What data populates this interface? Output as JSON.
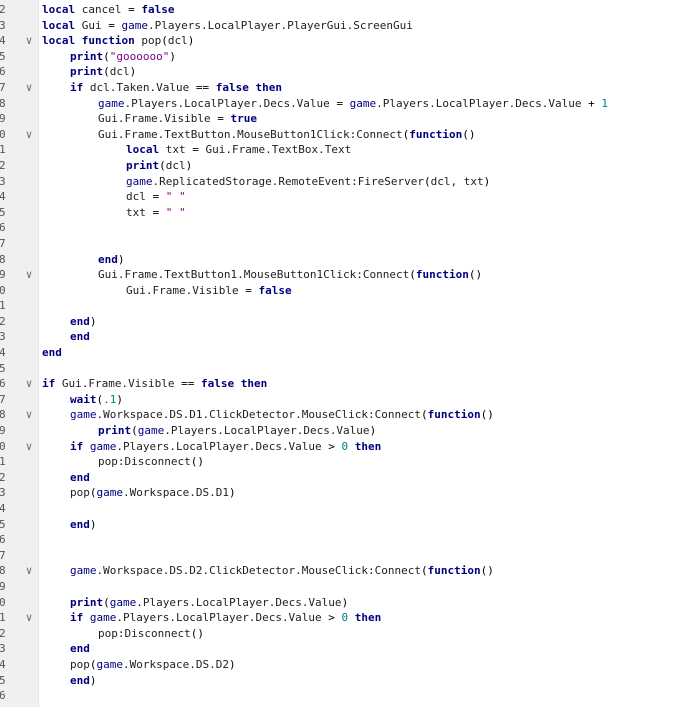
{
  "editor": {
    "colors": {
      "keyword": "#00007f",
      "string": "#7f007f",
      "number": "#007f7f",
      "text": "#1e1e1e",
      "gutter": "#f0f0f0"
    },
    "lines": [
      {
        "num": "2",
        "fold": false,
        "indent": 0,
        "tokens": [
          [
            "kw",
            "local"
          ],
          [
            "plain",
            " cancel "
          ],
          [
            "op",
            "="
          ],
          [
            "plain",
            " "
          ],
          [
            "kw",
            "false"
          ]
        ]
      },
      {
        "num": "3",
        "fold": false,
        "indent": 0,
        "tokens": [
          [
            "kw",
            "local"
          ],
          [
            "plain",
            " Gui "
          ],
          [
            "op",
            "="
          ],
          [
            "plain",
            " "
          ],
          [
            "glb",
            "game"
          ],
          [
            "plain",
            ".Players.LocalPlayer.PlayerGui.ScreenGui"
          ]
        ]
      },
      {
        "num": "4",
        "fold": true,
        "indent": 0,
        "tokens": [
          [
            "kw",
            "local"
          ],
          [
            "plain",
            " "
          ],
          [
            "kw",
            "function"
          ],
          [
            "plain",
            " pop"
          ],
          [
            "op",
            "("
          ],
          [
            "plain",
            "dcl"
          ],
          [
            "op",
            ")"
          ]
        ]
      },
      {
        "num": "5",
        "fold": false,
        "indent": 1,
        "tokens": [
          [
            "kw",
            "print"
          ],
          [
            "op",
            "("
          ],
          [
            "str",
            "\"goooooo\""
          ],
          [
            "op",
            ")"
          ]
        ]
      },
      {
        "num": "6",
        "fold": false,
        "indent": 1,
        "tokens": [
          [
            "kw",
            "print"
          ],
          [
            "op",
            "("
          ],
          [
            "plain",
            "dcl"
          ],
          [
            "op",
            ")"
          ]
        ]
      },
      {
        "num": "7",
        "fold": true,
        "indent": 1,
        "tokens": [
          [
            "kw",
            "if"
          ],
          [
            "plain",
            " dcl.Taken.Value "
          ],
          [
            "op",
            "=="
          ],
          [
            "plain",
            " "
          ],
          [
            "kw",
            "false"
          ],
          [
            "plain",
            " "
          ],
          [
            "kw",
            "then"
          ]
        ]
      },
      {
        "num": "8",
        "fold": false,
        "indent": 2,
        "tokens": [
          [
            "glb",
            "game"
          ],
          [
            "plain",
            ".Players.LocalPlayer.Decs.Value "
          ],
          [
            "op",
            "="
          ],
          [
            "plain",
            " "
          ],
          [
            "glb",
            "game"
          ],
          [
            "plain",
            ".Players.LocalPlayer.Decs.Value "
          ],
          [
            "op",
            "+"
          ],
          [
            "plain",
            " "
          ],
          [
            "num",
            "1"
          ]
        ]
      },
      {
        "num": "9",
        "fold": false,
        "indent": 2,
        "tokens": [
          [
            "plain",
            "Gui.Frame.Visible "
          ],
          [
            "op",
            "="
          ],
          [
            "plain",
            " "
          ],
          [
            "kw",
            "true"
          ]
        ]
      },
      {
        "num": "0",
        "fold": true,
        "indent": 2,
        "tokens": [
          [
            "plain",
            "Gui.Frame.TextButton.MouseButton1Click:Connect"
          ],
          [
            "op",
            "("
          ],
          [
            "kw",
            "function"
          ],
          [
            "op",
            "()"
          ]
        ]
      },
      {
        "num": "1",
        "fold": false,
        "indent": 3,
        "tokens": [
          [
            "kw",
            "local"
          ],
          [
            "plain",
            " txt "
          ],
          [
            "op",
            "="
          ],
          [
            "plain",
            " Gui.Frame.TextBox.Text"
          ]
        ]
      },
      {
        "num": "2",
        "fold": false,
        "indent": 3,
        "tokens": [
          [
            "kw",
            "print"
          ],
          [
            "op",
            "("
          ],
          [
            "plain",
            "dcl"
          ],
          [
            "op",
            ")"
          ]
        ]
      },
      {
        "num": "3",
        "fold": false,
        "indent": 3,
        "tokens": [
          [
            "glb",
            "game"
          ],
          [
            "plain",
            ".ReplicatedStorage.RemoteEvent:FireServer"
          ],
          [
            "op",
            "("
          ],
          [
            "plain",
            "dcl, txt"
          ],
          [
            "op",
            ")"
          ]
        ]
      },
      {
        "num": "4",
        "fold": false,
        "indent": 3,
        "tokens": [
          [
            "plain",
            "dcl "
          ],
          [
            "op",
            "="
          ],
          [
            "plain",
            " "
          ],
          [
            "str",
            "\" \""
          ]
        ]
      },
      {
        "num": "5",
        "fold": false,
        "indent": 3,
        "tokens": [
          [
            "plain",
            "txt "
          ],
          [
            "op",
            "="
          ],
          [
            "plain",
            " "
          ],
          [
            "str",
            "\" \""
          ]
        ]
      },
      {
        "num": "6",
        "fold": false,
        "indent": 0,
        "tokens": []
      },
      {
        "num": "7",
        "fold": false,
        "indent": 0,
        "tokens": []
      },
      {
        "num": "8",
        "fold": false,
        "indent": 2,
        "tokens": [
          [
            "kw",
            "end"
          ],
          [
            "op",
            ")"
          ]
        ]
      },
      {
        "num": "9",
        "fold": true,
        "indent": 2,
        "tokens": [
          [
            "plain",
            "Gui.Frame.TextButton1.MouseButton1Click:Connect"
          ],
          [
            "op",
            "("
          ],
          [
            "kw",
            "function"
          ],
          [
            "op",
            "()"
          ]
        ]
      },
      {
        "num": "0",
        "fold": false,
        "indent": 3,
        "tokens": [
          [
            "plain",
            "Gui.Frame.Visible "
          ],
          [
            "op",
            "="
          ],
          [
            "plain",
            " "
          ],
          [
            "kw",
            "false"
          ]
        ]
      },
      {
        "num": "1",
        "fold": false,
        "indent": 0,
        "tokens": []
      },
      {
        "num": "2",
        "fold": false,
        "indent": 1,
        "tokens": [
          [
            "kw",
            "end"
          ],
          [
            "op",
            ")"
          ]
        ]
      },
      {
        "num": "3",
        "fold": false,
        "indent": 1,
        "tokens": [
          [
            "kw",
            "end"
          ]
        ]
      },
      {
        "num": "4",
        "fold": false,
        "indent": 0,
        "tokens": [
          [
            "kw",
            "end"
          ]
        ]
      },
      {
        "num": "5",
        "fold": false,
        "indent": 0,
        "tokens": []
      },
      {
        "num": "6",
        "fold": true,
        "indent": 0,
        "tokens": [
          [
            "kw",
            "if"
          ],
          [
            "plain",
            " Gui.Frame.Visible "
          ],
          [
            "op",
            "=="
          ],
          [
            "plain",
            " "
          ],
          [
            "kw",
            "false"
          ],
          [
            "plain",
            " "
          ],
          [
            "kw",
            "then"
          ]
        ]
      },
      {
        "num": "7",
        "fold": false,
        "indent": 1,
        "tokens": [
          [
            "kw",
            "wait"
          ],
          [
            "op",
            "("
          ],
          [
            "num",
            ".1"
          ],
          [
            "op",
            ")"
          ]
        ]
      },
      {
        "num": "8",
        "fold": true,
        "indent": 1,
        "tokens": [
          [
            "glb",
            "game"
          ],
          [
            "plain",
            ".Workspace.DS.D1.ClickDetector.MouseClick:Connect"
          ],
          [
            "op",
            "("
          ],
          [
            "kw",
            "function"
          ],
          [
            "op",
            "()"
          ]
        ]
      },
      {
        "num": "9",
        "fold": false,
        "indent": 2,
        "tokens": [
          [
            "kw",
            "print"
          ],
          [
            "op",
            "("
          ],
          [
            "glb",
            "game"
          ],
          [
            "plain",
            ".Players.LocalPlayer.Decs.Value"
          ],
          [
            "op",
            ")"
          ]
        ]
      },
      {
        "num": "0",
        "fold": true,
        "indent": 1,
        "tokens": [
          [
            "kw",
            "if"
          ],
          [
            "plain",
            " "
          ],
          [
            "glb",
            "game"
          ],
          [
            "plain",
            ".Players.LocalPlayer.Decs.Value "
          ],
          [
            "op",
            ">"
          ],
          [
            "plain",
            " "
          ],
          [
            "num",
            "0"
          ],
          [
            "plain",
            " "
          ],
          [
            "kw",
            "then"
          ]
        ]
      },
      {
        "num": "1",
        "fold": false,
        "indent": 2,
        "tokens": [
          [
            "plain",
            "pop:Disconnect"
          ],
          [
            "op",
            "()"
          ]
        ]
      },
      {
        "num": "2",
        "fold": false,
        "indent": 1,
        "tokens": [
          [
            "kw",
            "end"
          ]
        ]
      },
      {
        "num": "3",
        "fold": false,
        "indent": 1,
        "tokens": [
          [
            "plain",
            "pop"
          ],
          [
            "op",
            "("
          ],
          [
            "glb",
            "game"
          ],
          [
            "plain",
            ".Workspace.DS.D1"
          ],
          [
            "op",
            ")"
          ]
        ]
      },
      {
        "num": "4",
        "fold": false,
        "indent": 0,
        "tokens": []
      },
      {
        "num": "5",
        "fold": false,
        "indent": 1,
        "tokens": [
          [
            "kw",
            "end"
          ],
          [
            "op",
            ")"
          ]
        ]
      },
      {
        "num": "6",
        "fold": false,
        "indent": 0,
        "tokens": []
      },
      {
        "num": "7",
        "fold": false,
        "indent": 0,
        "tokens": []
      },
      {
        "num": "8",
        "fold": true,
        "indent": 1,
        "tokens": [
          [
            "glb",
            "game"
          ],
          [
            "plain",
            ".Workspace.DS.D2.ClickDetector.MouseClick:Connect"
          ],
          [
            "op",
            "("
          ],
          [
            "kw",
            "function"
          ],
          [
            "op",
            "()"
          ]
        ]
      },
      {
        "num": "9",
        "fold": false,
        "indent": 0,
        "tokens": []
      },
      {
        "num": "0",
        "fold": false,
        "indent": 1,
        "tokens": [
          [
            "kw",
            "print"
          ],
          [
            "op",
            "("
          ],
          [
            "glb",
            "game"
          ],
          [
            "plain",
            ".Players.LocalPlayer.Decs.Value"
          ],
          [
            "op",
            ")"
          ]
        ]
      },
      {
        "num": "1",
        "fold": true,
        "indent": 1,
        "tokens": [
          [
            "kw",
            "if"
          ],
          [
            "plain",
            " "
          ],
          [
            "glb",
            "game"
          ],
          [
            "plain",
            ".Players.LocalPlayer.Decs.Value "
          ],
          [
            "op",
            ">"
          ],
          [
            "plain",
            " "
          ],
          [
            "num",
            "0"
          ],
          [
            "plain",
            " "
          ],
          [
            "kw",
            "then"
          ]
        ]
      },
      {
        "num": "2",
        "fold": false,
        "indent": 2,
        "tokens": [
          [
            "plain",
            "pop:Disconnect"
          ],
          [
            "op",
            "()"
          ]
        ]
      },
      {
        "num": "3",
        "fold": false,
        "indent": 1,
        "tokens": [
          [
            "kw",
            "end"
          ]
        ]
      },
      {
        "num": "4",
        "fold": false,
        "indent": 1,
        "tokens": [
          [
            "plain",
            "pop"
          ],
          [
            "op",
            "("
          ],
          [
            "glb",
            "game"
          ],
          [
            "plain",
            ".Workspace.DS.D2"
          ],
          [
            "op",
            ")"
          ]
        ]
      },
      {
        "num": "5",
        "fold": false,
        "indent": 1,
        "tokens": [
          [
            "kw",
            "end"
          ],
          [
            "op",
            ")"
          ]
        ]
      },
      {
        "num": "6",
        "fold": false,
        "indent": 0,
        "tokens": []
      }
    ]
  }
}
